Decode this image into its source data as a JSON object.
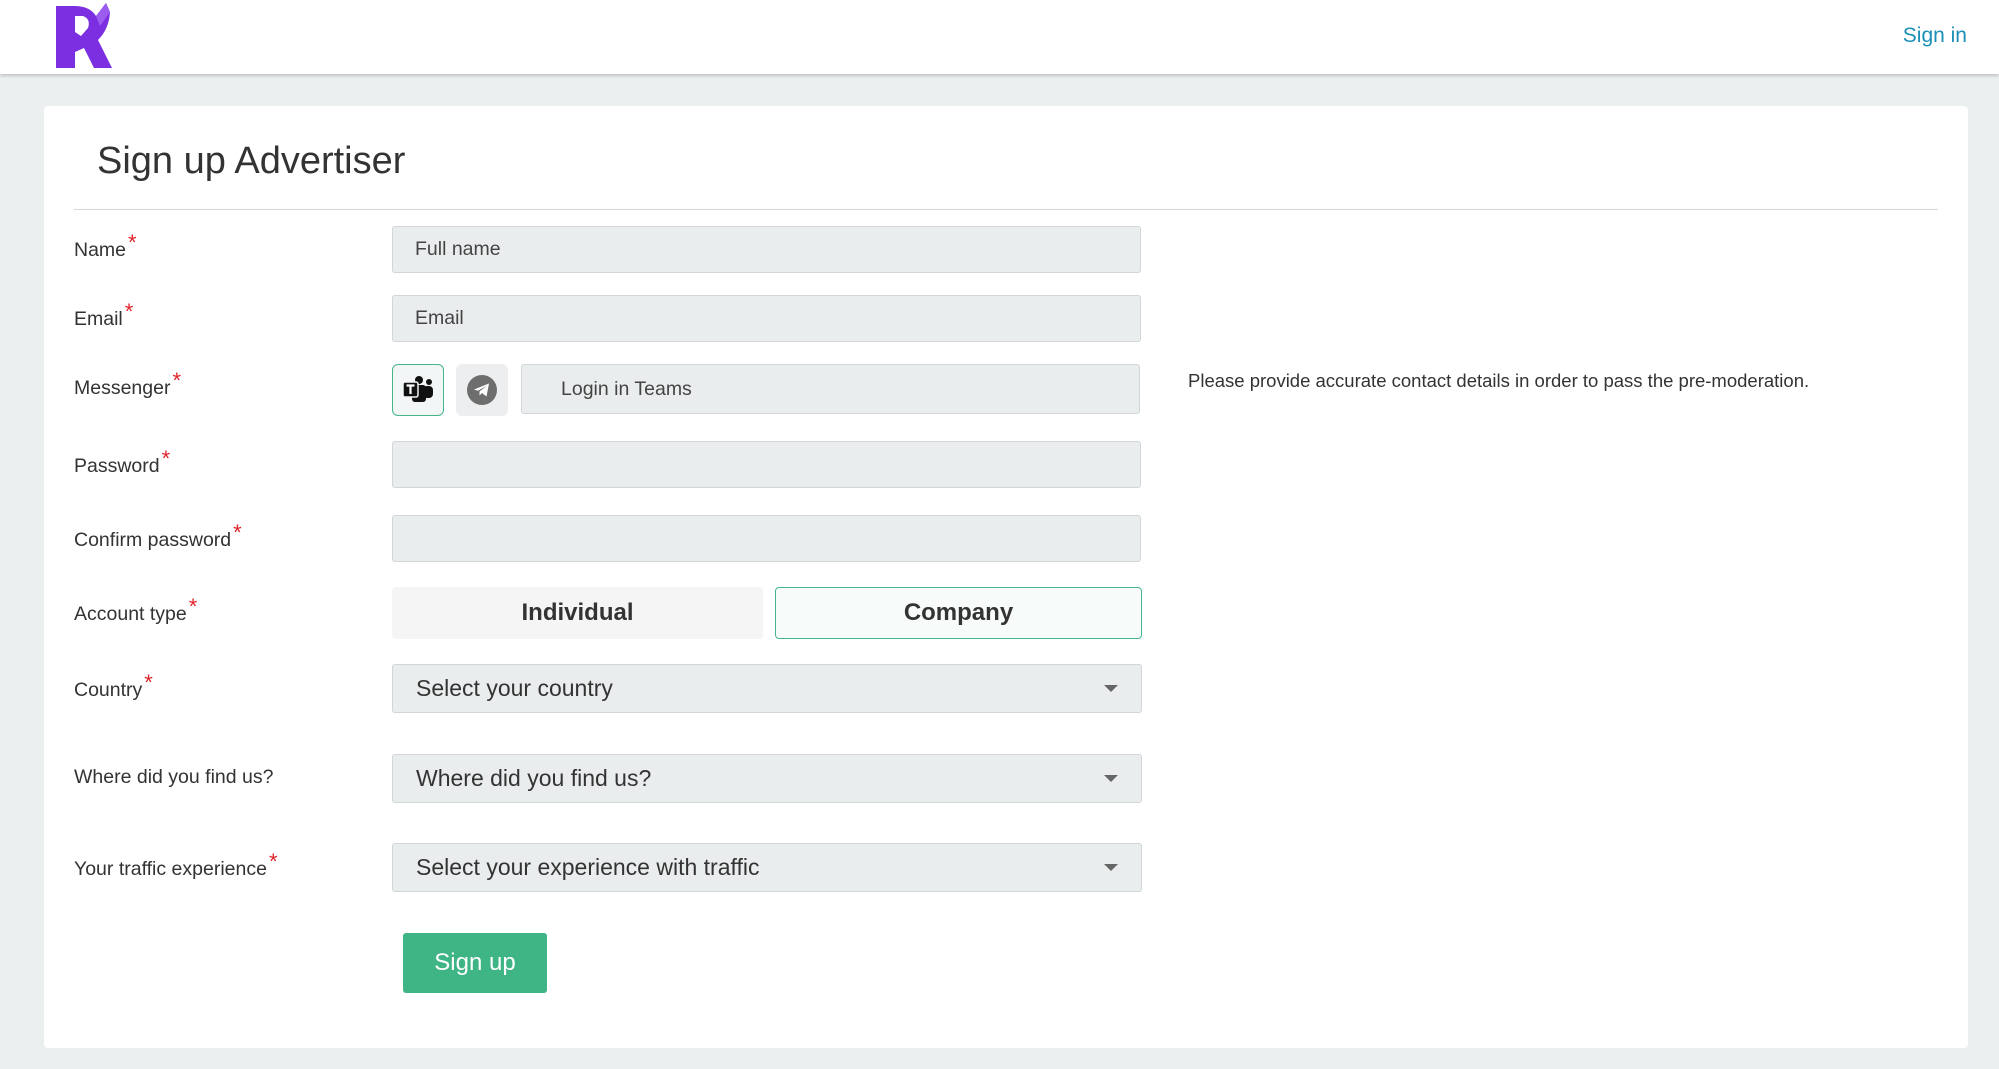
{
  "header": {
    "sign_in_label": "Sign in"
  },
  "form": {
    "title": "Sign up Advertiser",
    "name": {
      "label": "Name",
      "placeholder": "Full name",
      "value": ""
    },
    "email": {
      "label": "Email",
      "placeholder": "Email",
      "value": ""
    },
    "messenger": {
      "label": "Messenger",
      "options": [
        "teams-icon",
        "telegram-icon"
      ],
      "selected": "Teams",
      "placeholder": "Login in Teams",
      "value": ""
    },
    "password": {
      "label": "Password",
      "value": ""
    },
    "confirm_password": {
      "label": "Confirm password",
      "value": ""
    },
    "account_type": {
      "label": "Account type",
      "options": [
        "Individual",
        "Company"
      ],
      "selected": "Company"
    },
    "country": {
      "label": "Country",
      "value": "Select your country"
    },
    "find_us": {
      "label": "Where did you find us?",
      "value": "Where did you find us?"
    },
    "traffic": {
      "label": "Your traffic experience",
      "value": "Select your experience with traffic"
    },
    "required_mark": "*",
    "hint": "Please provide accurate contact details in order to pass the pre-moderation.",
    "submit_label": "Sign up"
  },
  "colors": {
    "accent": "#3fb585",
    "link": "#1b8fb6",
    "required": "#e0242b",
    "logo": "#7b2fe0"
  }
}
